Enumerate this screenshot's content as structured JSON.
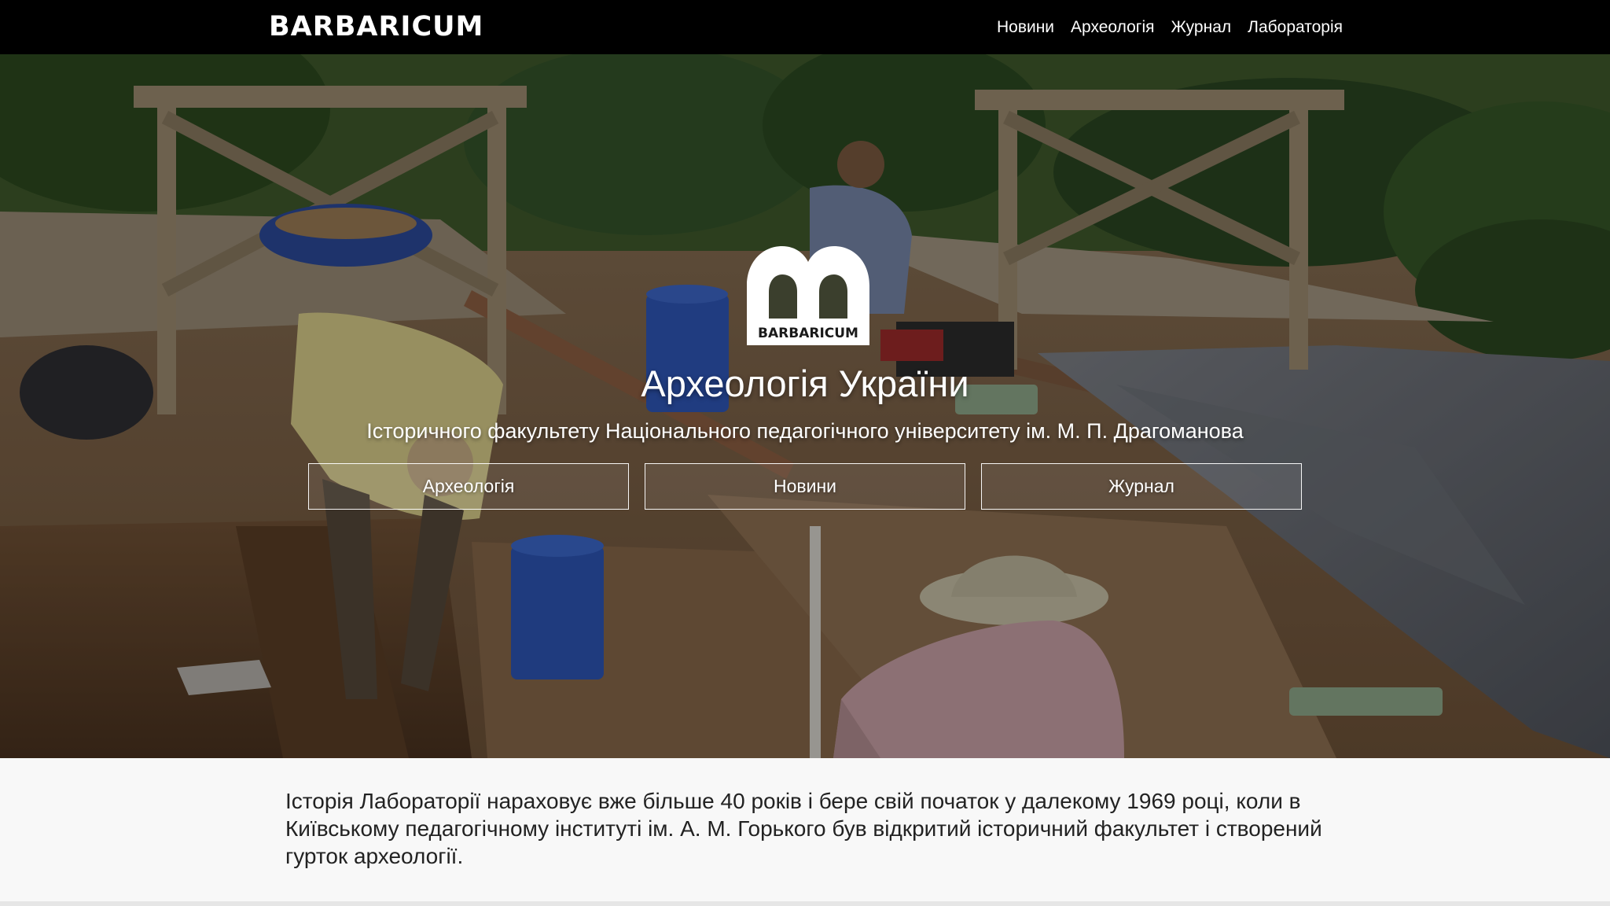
{
  "header": {
    "brand": "BARBARICUM",
    "nav": [
      "Новини",
      "Археологія",
      "Журнал",
      "Лабораторія"
    ]
  },
  "hero": {
    "logo_text": "BARBARICUM",
    "title": "Археологія України",
    "subtitle": "Історичного факультету Національного педагогічного університету ім. М. П. Драгоманова",
    "buttons": [
      "Археологія",
      "Новини",
      "Журнал"
    ]
  },
  "intro": {
    "text": "Історія Лабораторії нараховує вже більше 40 років і бере свій початок у далекому 1969 році, коли в Київському педагогічному інституті ім. А. М. Горького був відкритий історичний факультет і створений гурток археології."
  }
}
